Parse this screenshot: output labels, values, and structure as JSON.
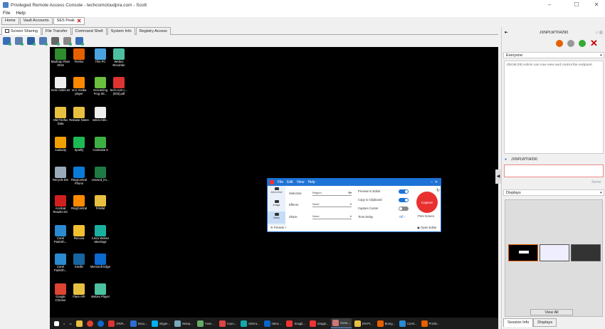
{
  "window": {
    "title": "Privileged Remote Access Console - techcomcloudpra.com - Scott"
  },
  "menu": [
    "File",
    "Help"
  ],
  "page_tabs": [
    {
      "label": "Home"
    },
    {
      "label": "Vault Accounts"
    },
    {
      "label": "SES Peak",
      "closable": true
    }
  ],
  "function_tabs": [
    "Screen Sharing",
    "File Transfer",
    "Command Shell",
    "System Info",
    "Registry Access"
  ],
  "desktop_icons": [
    {
      "label": "MadCap Flare 2019",
      "color": "#2e8b2e"
    },
    {
      "label": "Firefox",
      "color": "#e66000"
    },
    {
      "label": "This PC",
      "color": "#4aa3df"
    },
    {
      "label": "Webex Recorder",
      "color": "#4cc0a0"
    },
    {
      "label": "mmc notes.txt",
      "color": "#eeeeee"
    },
    {
      "label": "VLC media player",
      "color": "#ff8800"
    },
    {
      "label": "Screaming Frog SE...",
      "color": "#6abf3c"
    },
    {
      "label": "tech-com-c... (003).pdf",
      "color": "#d33"
    },
    {
      "label": "Old Firefox Data",
      "color": "#e8c040"
    },
    {
      "label": "Release Notes",
      "color": "#e8c040"
    },
    {
      "label": "notes-mikr...",
      "color": "#eeeeee"
    },
    {
      "label": "Audacity",
      "color": "#f2a000"
    },
    {
      "label": "Spotify",
      "color": "#1db954"
    },
    {
      "label": "Camtasia 9",
      "color": "#3cb043"
    },
    {
      "label": "Recycle Bin",
      "color": "#9ab"
    },
    {
      "label": "RingCentral Phone",
      "color": "#0a7bd6"
    },
    {
      "label": "Unused_lm...",
      "color": "#1e7a44"
    },
    {
      "label": "Acrobat Reader DC",
      "color": "#d01f1f"
    },
    {
      "label": "RingCentral",
      "color": "#ff8a00"
    },
    {
      "label": "PAMM",
      "color": "#e8c040"
    },
    {
      "label": "Corel PaintSh...",
      "color": "#2b8ad0"
    },
    {
      "label": "Recuva",
      "color": "#f0c030"
    },
    {
      "label": "Cisco Webex Meetings",
      "color": "#1ab0a0"
    },
    {
      "label": "Corel PaintSh...",
      "color": "#2b8ad0"
    },
    {
      "label": "Kindle",
      "color": "#1565a0"
    },
    {
      "label": "Microsoft Edge",
      "color": "#0a6ad0"
    },
    {
      "label": "Google Chrome",
      "color": "#dd4433"
    },
    {
      "label": "Flare API",
      "color": "#e8c040"
    },
    {
      "label": "Webex Player",
      "color": "#4cc0a0"
    }
  ],
  "snagit": {
    "menu": [
      "File",
      "Edit",
      "View",
      "Help"
    ],
    "modes": [
      "All-in-One",
      "Image",
      "Video"
    ],
    "labels": {
      "selection": "Selection:",
      "effects": "Effects:",
      "share": "Share:",
      "preview": "Preview in Editor",
      "clipboard": "Copy to Clipboard",
      "cursor": "Capture Cursor",
      "delay": "Time Delay",
      "presets": "Presets",
      "open_editor": "Open Editor",
      "capture": "Capture",
      "print_screen": "Print Screen"
    },
    "values": {
      "selection": "Region",
      "effects": "None",
      "share": "None",
      "delay": "Off"
    },
    "toggles": {
      "preview": true,
      "clipboard": true,
      "cursor": false
    }
  },
  "taskbar": [
    {
      "label": "(FER...",
      "color": "#d33"
    },
    {
      "label": "Docu...",
      "color": "#2b6cd0"
    },
    {
      "label": "Skype...",
      "color": "#00aff0"
    },
    {
      "label": "Notep...",
      "color": "#7ab"
    },
    {
      "label": "*new ...",
      "color": "#6a6"
    },
    {
      "label": "Coun...",
      "color": "#d44"
    },
    {
      "label": "GitKra...",
      "color": "#1aa"
    },
    {
      "label": "Inbox ...",
      "color": "#0a64c8"
    },
    {
      "label": "Snagit...",
      "color": "#e33"
    },
    {
      "label": "Snagit...",
      "color": "#e33"
    },
    {
      "label": "Gene...",
      "color": "#c77"
    },
    {
      "label": "EN-Pr...",
      "color": "#e8c040"
    },
    {
      "label": "Bomg...",
      "color": "#e66000"
    },
    {
      "label": "Corel...",
      "color": "#2b8ad0"
    },
    {
      "label": "Privile...",
      "color": "#e66000"
    }
  ],
  "right_panel": {
    "endpoint": "JXNPLWT04290",
    "everyone_label": "Everyone",
    "chat_message": "(08:56:29) Admin can now view and control the endpoint.",
    "user": "JXNPLWT04290",
    "send_label": "Send",
    "displays_label": "Displays",
    "view_all": "View All",
    "bottom_tabs": [
      "Session Info",
      "Displays"
    ]
  }
}
